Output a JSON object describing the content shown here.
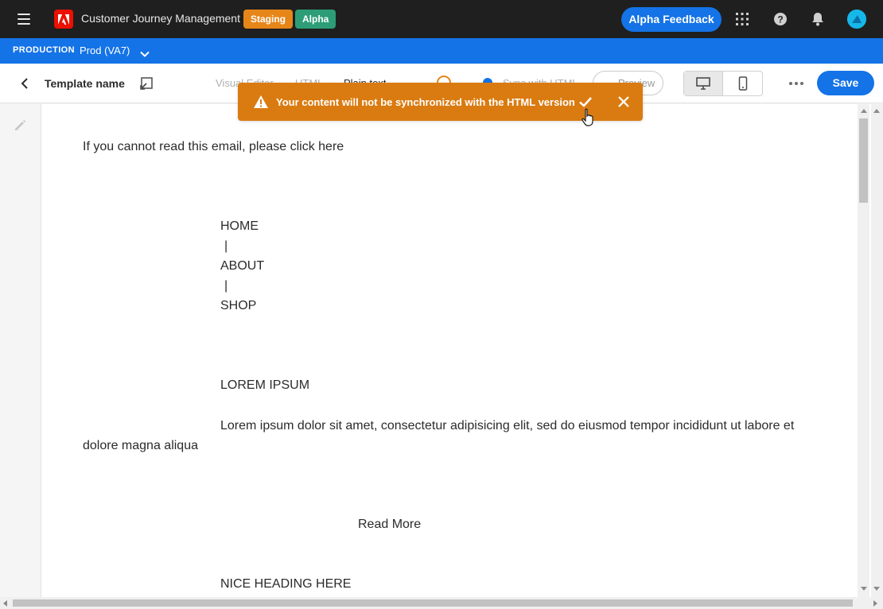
{
  "shell": {
    "app_title": "Customer Journey Management",
    "badges": {
      "staging": "Staging",
      "alpha": "Alpha"
    },
    "feedback_label": "Alpha Feedback"
  },
  "org": {
    "environment": "PRODUCTION",
    "sandbox": "Prod (VA7)"
  },
  "toolbar": {
    "template_name": "Template name",
    "tabs": {
      "visual": "Visual Editor",
      "html": "HTML",
      "plain": "Plain text"
    },
    "sync_label": "Sync with HTML",
    "preview_label": "Preview",
    "save_label": "Save"
  },
  "toast": {
    "message": "Your content will not be synchronized with the HTML version"
  },
  "content": {
    "intro": "If you cannot read this email, please  click here",
    "nav_home": "HOME",
    "sep1": "|",
    "nav_about": "ABOUT",
    "sep2": "|",
    "nav_shop": "SHOP",
    "heading": "LOREM IPSUM",
    "paragraph": "Lorem ipsum dolor sit amet, consectetur adipisicing elit, sed do eiusmod tempor incididunt ut labore et dolore magna aliqua",
    "read_more": "Read More",
    "heading2": "NICE HEADING HERE"
  },
  "colors": {
    "shell_bg": "#1f1f1f",
    "orgbar_bg": "#1473e6",
    "accent": "#1473e6",
    "staging": "#e68619",
    "alpha": "#2d9d78",
    "toast_bg": "#da7b11"
  },
  "icons": {
    "hamburger": "hamburger-menu-icon",
    "logo": "adobe-logo-icon",
    "apps": "apps-grid-icon",
    "help": "help-icon",
    "notifications": "bell-icon",
    "back": "chevron-left-icon",
    "edit": "edit-name-icon",
    "warning": "warning-icon",
    "confirm": "checkmark-icon",
    "close": "close-icon"
  }
}
